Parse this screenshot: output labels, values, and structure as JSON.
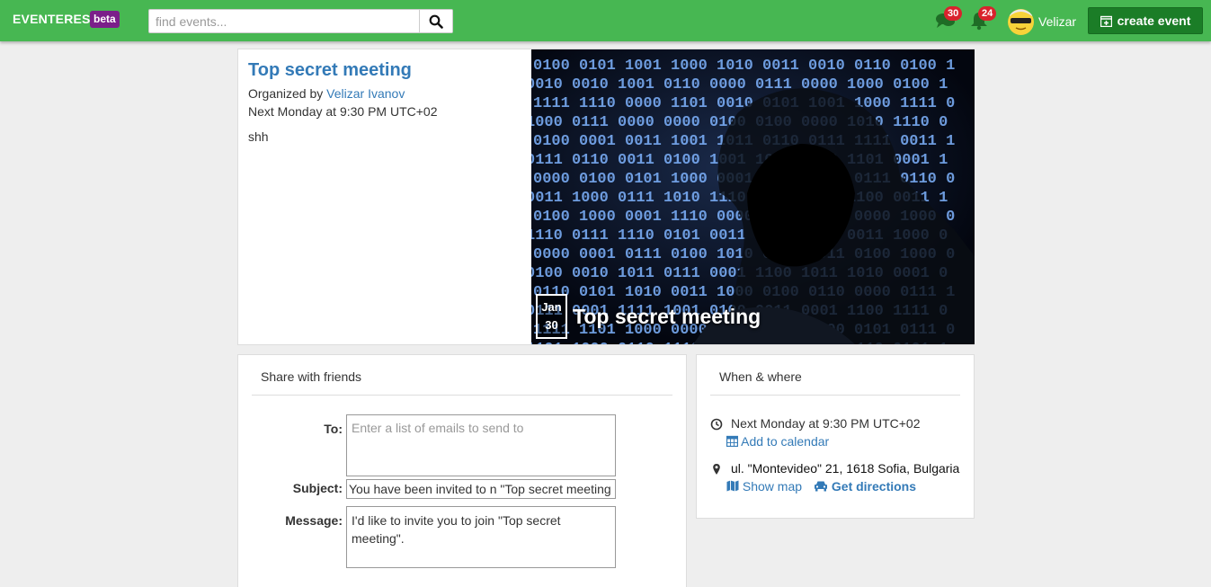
{
  "navbar": {
    "brand": "EVENTERES",
    "beta": "beta",
    "search_placeholder": "find events...",
    "messages_count": "30",
    "notifications_count": "24",
    "username": "Velizar",
    "create_label": "create event",
    "accent": "#47b752"
  },
  "event": {
    "title": "Top secret meeting",
    "organized_by_label": "Organized by",
    "organizer": "Velizar Ivanov",
    "time": "Next Monday at 9:30 PM UTC+02",
    "description": "shh",
    "date_month": "Jan",
    "date_day": "30",
    "image_title": "Top secret meeting"
  },
  "share": {
    "heading": "Share with friends",
    "to_label": "To:",
    "to_placeholder": "Enter a list of emails to send to",
    "subject_label": "Subject:",
    "subject_value": "You have been invited to n \"Top secret meeting",
    "message_label": "Message:",
    "message_value": "I'd like to invite you to join \"Top secret meeting\"."
  },
  "where": {
    "heading": "When & where",
    "time": "Next Monday at 9:30 PM UTC+02",
    "add_calendar": "Add to calendar",
    "address": "ul. \"Montevideo\" 21, 1618 Sofia, Bulgaria",
    "show_map": "Show map",
    "get_directions": "Get directions"
  }
}
